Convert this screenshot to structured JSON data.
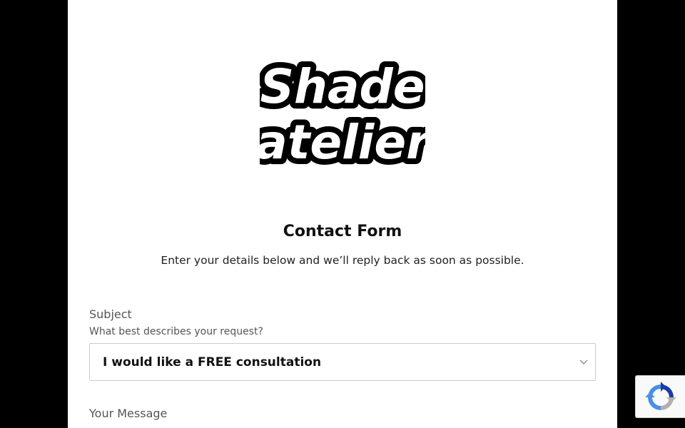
{
  "logo": {
    "line1": "Shade",
    "line2": "atelier"
  },
  "header": {
    "title": "Contact Form",
    "subtitle": "Enter your details below and we’ll reply back as soon as possible."
  },
  "form": {
    "subject": {
      "label": "Subject",
      "help": "What best describes your request?",
      "selected": "I would like a FREE consultation",
      "icon": "chevron-down-icon"
    },
    "message": {
      "label": "Your Message"
    }
  },
  "recaptcha": {
    "icon": "recaptcha-icon"
  },
  "colors": {
    "background": "#000000",
    "page": "#ffffff",
    "text": "#111111",
    "muted": "#555555",
    "border": "#cccccc",
    "recaptcha_blue": "#1c3aa9",
    "recaptcha_light_blue": "#4a90e2",
    "recaptcha_gray": "#b0b0b0"
  }
}
